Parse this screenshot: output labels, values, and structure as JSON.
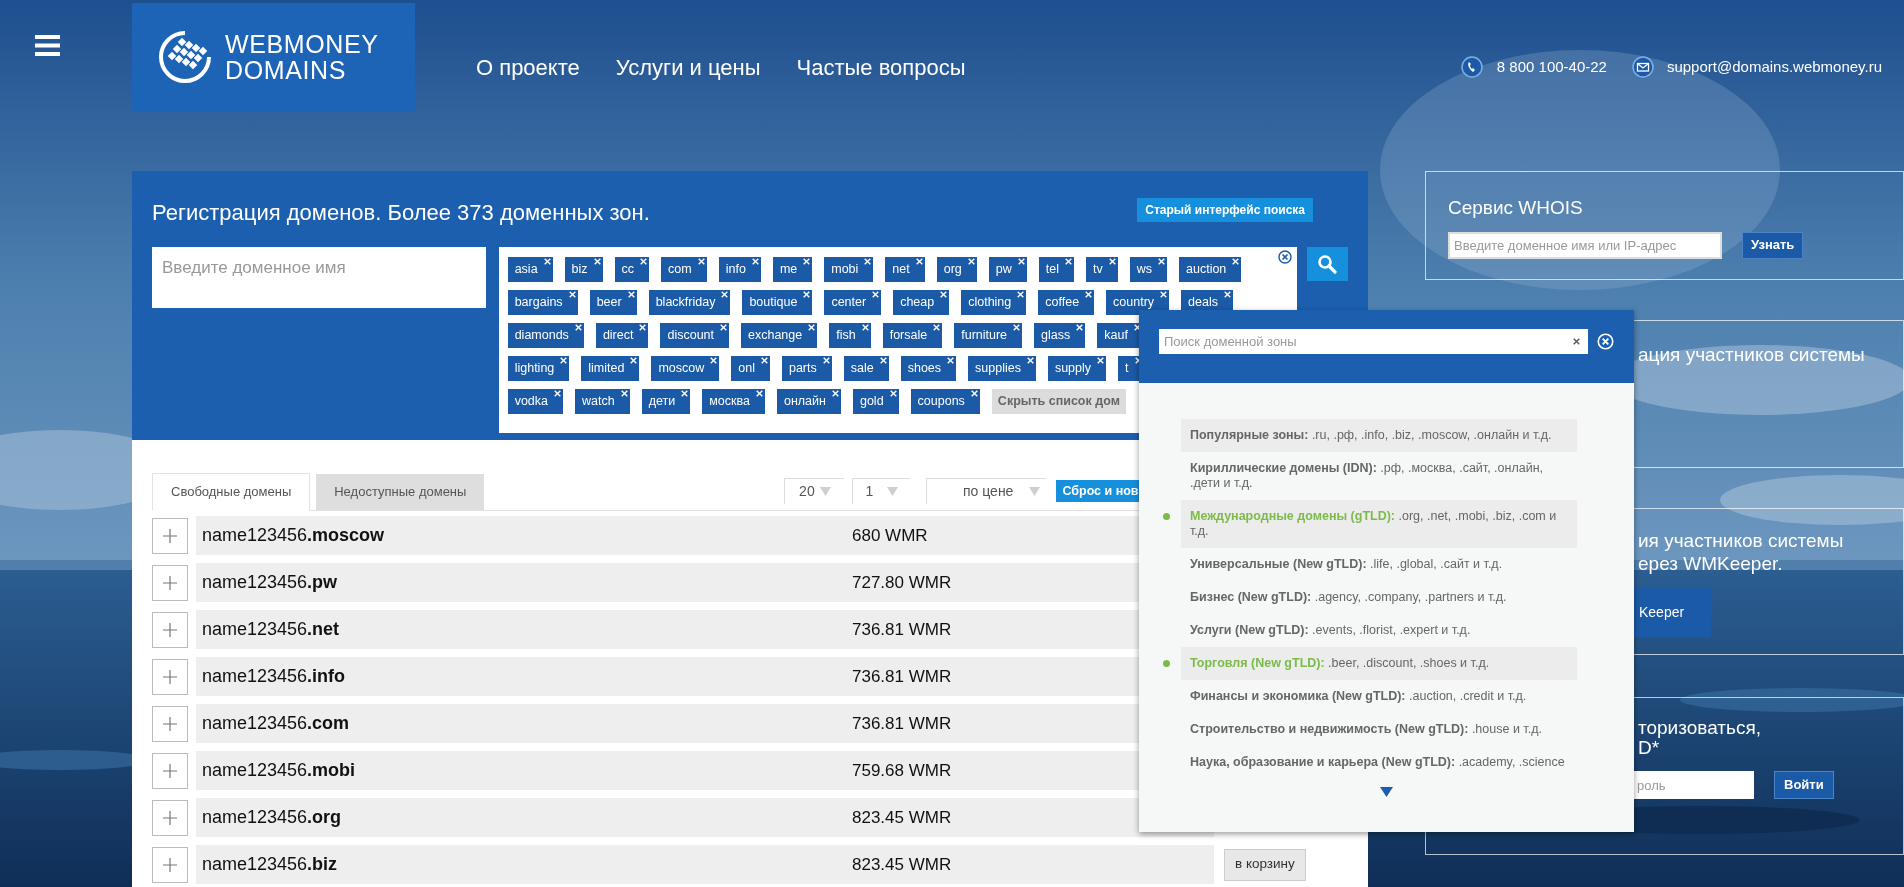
{
  "header": {
    "logo": {
      "line_1": "WEBMONEY",
      "line_2": "DOMAINS"
    },
    "nav": [
      "О проекте",
      "Услуги и цены",
      "Частые вопросы"
    ],
    "phone": "8 800 100-40-22",
    "email": "support@domains.webmoney.ru"
  },
  "search_panel": {
    "title": "Регистрация доменов. Более 373 доменных зон.",
    "old_interface_button": "Старый интерфейс поиска",
    "domain_input": {
      "placeholder": "Введите доменное имя"
    },
    "zone_tag_rows": [
      {
        "tags": [
          "asia",
          "biz",
          "cc",
          "com",
          "info",
          "me",
          "mobi",
          "net",
          "org",
          "pw",
          "tel",
          "tv",
          "ws",
          "auction"
        ]
      },
      {
        "tags": [
          "bargains",
          "beer",
          "blackfriday",
          "boutique",
          "center",
          "cheap",
          "clothing",
          "coffee",
          "country",
          "deals"
        ]
      },
      {
        "tags": [
          "diamonds",
          "direct",
          "discount",
          "exchange",
          "fish",
          "forsale",
          "furniture",
          "glass",
          "kauf"
        ]
      },
      {
        "tags": [
          "lighting",
          "limited",
          "moscow",
          "onl",
          "parts",
          "sale",
          "shoes",
          "supplies",
          "supply",
          "t"
        ]
      },
      {
        "tags": [
          "vodka",
          "watch",
          "дети",
          "москва",
          "онлайн",
          "gold",
          "coupons"
        ]
      }
    ],
    "hide_list_button": "Скрыть список дом"
  },
  "results": {
    "tabs": [
      {
        "label": "Свободные домены",
        "selected": true
      },
      {
        "label": "Недоступные домены",
        "selected": false
      }
    ],
    "per_page": "20",
    "page": "1",
    "sort": "по цене",
    "reset_button": "Сброс и нов",
    "rows": [
      {
        "domain": "name123456**.moscow**",
        "price": "680 WMR"
      },
      {
        "domain": "name123456**.pw**",
        "price": "727.80 WMR"
      },
      {
        "domain": "name123456**.net**",
        "price": "736.81 WMR"
      },
      {
        "domain": "name123456**.info**",
        "price": "736.81 WMR"
      },
      {
        "domain": "name123456**.com**",
        "price": "736.81 WMR"
      },
      {
        "domain": "name123456**.mobi**",
        "price": "759.68 WMR"
      },
      {
        "domain": "name123456**.org**",
        "price": "823.45 WMR"
      },
      {
        "domain": "name123456**.biz**",
        "price": "823.45 WMR",
        "cart_button": "в корзину"
      }
    ]
  },
  "sidebar": {
    "whois": {
      "title": "Сервис WHOIS",
      "input": {
        "placeholder": "Введите доменное имя или IP-адрес"
      },
      "button": "Узнать"
    },
    "card_2": {
      "text": "ация участников системы"
    },
    "card_3": {
      "lines": [
        "ия участников системы",
        "ерез WMKeeper."
      ],
      "button": "Keeper"
    },
    "card_4": {
      "lines": [
        "торизоваться,",
        "D*"
      ],
      "password": {
        "placeholder": "роль"
      },
      "button": "Войти"
    }
  },
  "zone_popup": {
    "search": {
      "placeholder": "Поиск доменной зоны"
    },
    "categories": [
      {
        "text": "**Популярные зоны:** .ru, .рф, .info, .biz, .moscow, .онлайн и т.д.",
        "highlighted": true,
        "selected": false
      },
      {
        "text": "**Кириллические домены (IDN):** .рф, .москва, .сайт, .онлайн, .дети и т.д.",
        "highlighted": false,
        "selected": false
      },
      {
        "text": "**Международные домены (gTLD):** .org, .net, .mobi, .biz, .com и т.д.",
        "highlighted": true,
        "selected": true
      },
      {
        "text": "**Универсальные (New gTLD):** .life, .global, .сайт и т.д.",
        "highlighted": false,
        "selected": false
      },
      {
        "text": "**Бизнес (New gTLD):** .agency, .company, .partners и т.д.",
        "highlighted": false,
        "selected": false
      },
      {
        "text": "**Услуги (New gTLD):** .events, .florist, .expert и т.д.",
        "highlighted": false,
        "selected": false
      },
      {
        "text": "**Торговля (New gTLD):** .beer, .discount, .shoes и т.д.",
        "highlighted": true,
        "selected": true
      },
      {
        "text": "**Финансы и экономика (New gTLD):** .auction, .credit и т.д.",
        "highlighted": false,
        "selected": false
      },
      {
        "text": "**Строительство и недвижимость (New gTLD):** .house и т.д.",
        "highlighted": false,
        "selected": false
      },
      {
        "text": "**Наука, образование и карьера (New gTLD):** .academy, .science",
        "highlighted": false,
        "selected": false
      }
    ]
  }
}
